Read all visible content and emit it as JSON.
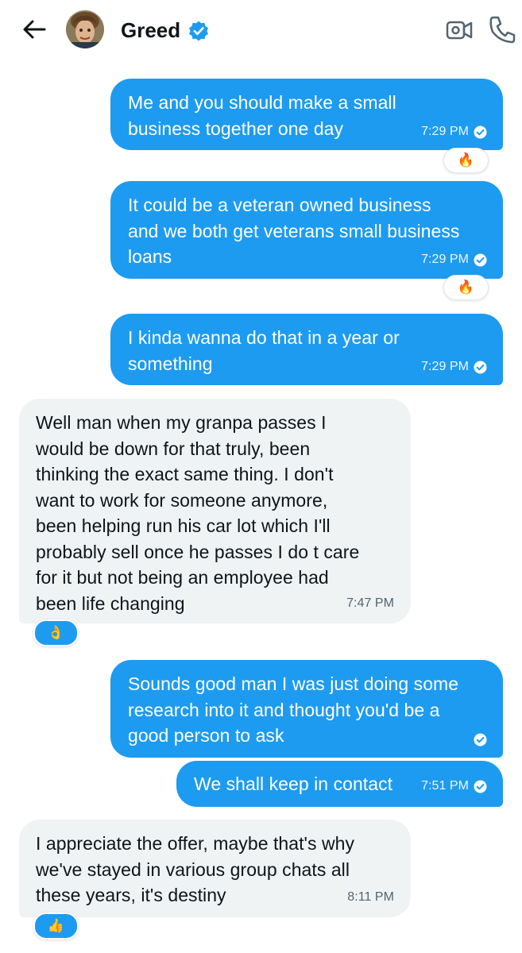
{
  "header": {
    "contact_name": "Greed",
    "back_icon": "arrow-left-icon",
    "verified_icon": "verified-badge-icon",
    "video_icon": "video-call-icon",
    "call_icon": "phone-icon"
  },
  "colors": {
    "outgoing_bubble": "#1d9bf0",
    "incoming_bubble": "#eff3f4",
    "text_primary": "#0f1419",
    "text_secondary": "#536471"
  },
  "messages": [
    {
      "direction": "outgoing",
      "text": "Me and you should make a small\nbusiness together one day",
      "time": "7:29 PM",
      "reaction": "🔥"
    },
    {
      "direction": "outgoing",
      "text": "It could be a veteran owned business\nand we both get veterans small business\nloans",
      "time": "7:29 PM",
      "reaction": "🔥"
    },
    {
      "direction": "outgoing",
      "text": "I kinda wanna do that in a year or\nsomething",
      "time": "7:29 PM",
      "reaction": ""
    },
    {
      "direction": "incoming",
      "text": "Well man when my granpa passes I\nwould be down for that truly, been\nthinking the exact same thing. I don't\nwant to work for someone anymore,\nbeen helping run his car lot which I'll\nprobably sell once he passes I do t care\nfor it but not being an employee had\nbeen life changing",
      "time": "7:47 PM",
      "reaction": "👌"
    },
    {
      "direction": "outgoing",
      "text": "Sounds good man I was just doing some\nresearch into it and thought you'd be a\ngood person to ask",
      "time": "",
      "reaction": ""
    },
    {
      "direction": "outgoing",
      "text": "We shall keep in contact",
      "time": "7:51 PM",
      "reaction": ""
    },
    {
      "direction": "incoming",
      "text": "I appreciate the offer, maybe that's why\nwe've stayed in various group chats all\nthese years, it's destiny",
      "time": "8:11 PM",
      "reaction": "👍"
    }
  ]
}
